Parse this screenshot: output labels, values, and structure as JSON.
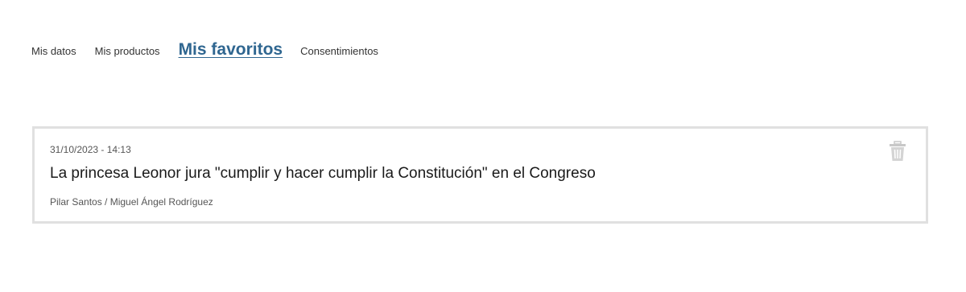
{
  "tabs": [
    {
      "label": "Mis datos",
      "active": false
    },
    {
      "label": "Mis productos",
      "active": false
    },
    {
      "label": "Mis favoritos",
      "active": true
    },
    {
      "label": "Consentimientos",
      "active": false
    }
  ],
  "favorites": [
    {
      "date": "31/10/2023 - 14:13",
      "title": "La princesa Leonor jura \"cumplir y hacer cumplir la Constitución\" en el Congreso",
      "authors": "Pilar Santos / Miguel Ángel Rodríguez",
      "delete_icon": "trash-icon"
    }
  ],
  "colors": {
    "active_tab": "#2f6690",
    "card_border": "#e0e0e0",
    "icon": "#c8c8c8"
  }
}
